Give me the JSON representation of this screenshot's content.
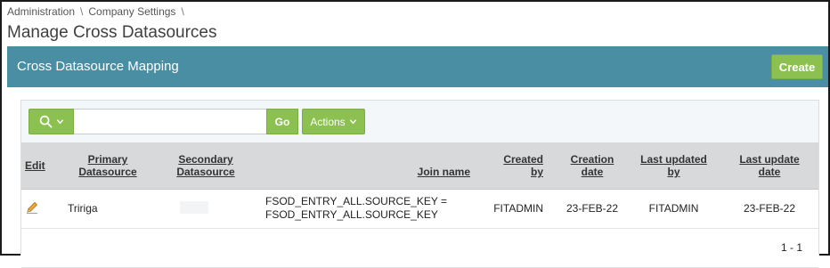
{
  "breadcrumb": [
    "Administration",
    "Company Settings"
  ],
  "breadcrumb_sep": "\\",
  "page": {
    "title": "Manage Cross Datasources"
  },
  "region": {
    "title": "Cross Datasource Mapping",
    "create_label": "Create"
  },
  "toolbar": {
    "search_value": "",
    "go_label": "Go",
    "actions_label": "Actions"
  },
  "table": {
    "headers": {
      "edit": "Edit",
      "primary_1": "Primary",
      "primary_2": "Datasource",
      "secondary_1": "Secondary",
      "secondary_2": "Datasource",
      "join": "Join name",
      "created_by_1": "Created",
      "created_by_2": "by",
      "creation_date_1": "Creation",
      "creation_date_2": "date",
      "last_updated_by_1": "Last updated",
      "last_updated_by_2": "by",
      "last_update_date_1": "Last update",
      "last_update_date_2": "date"
    },
    "rows": [
      {
        "primary": "Tririga",
        "secondary": "",
        "join_1": "FSOD_ENTRY_ALL.SOURCE_KEY =",
        "join_2": "FSOD_ENTRY_ALL.SOURCE_KEY",
        "created_by": "FITADMIN",
        "creation_date": "23-FEB-22",
        "last_updated_by": "FITADMIN",
        "last_update_date": "23-FEB-22"
      }
    ],
    "pagination": "1 - 1"
  },
  "colors": {
    "header_bar": "#4a8ea3",
    "button_green": "#8cc152"
  },
  "icons": {
    "search": "search-icon",
    "edit": "pencil-icon",
    "chevron": "chevron-down-icon"
  }
}
